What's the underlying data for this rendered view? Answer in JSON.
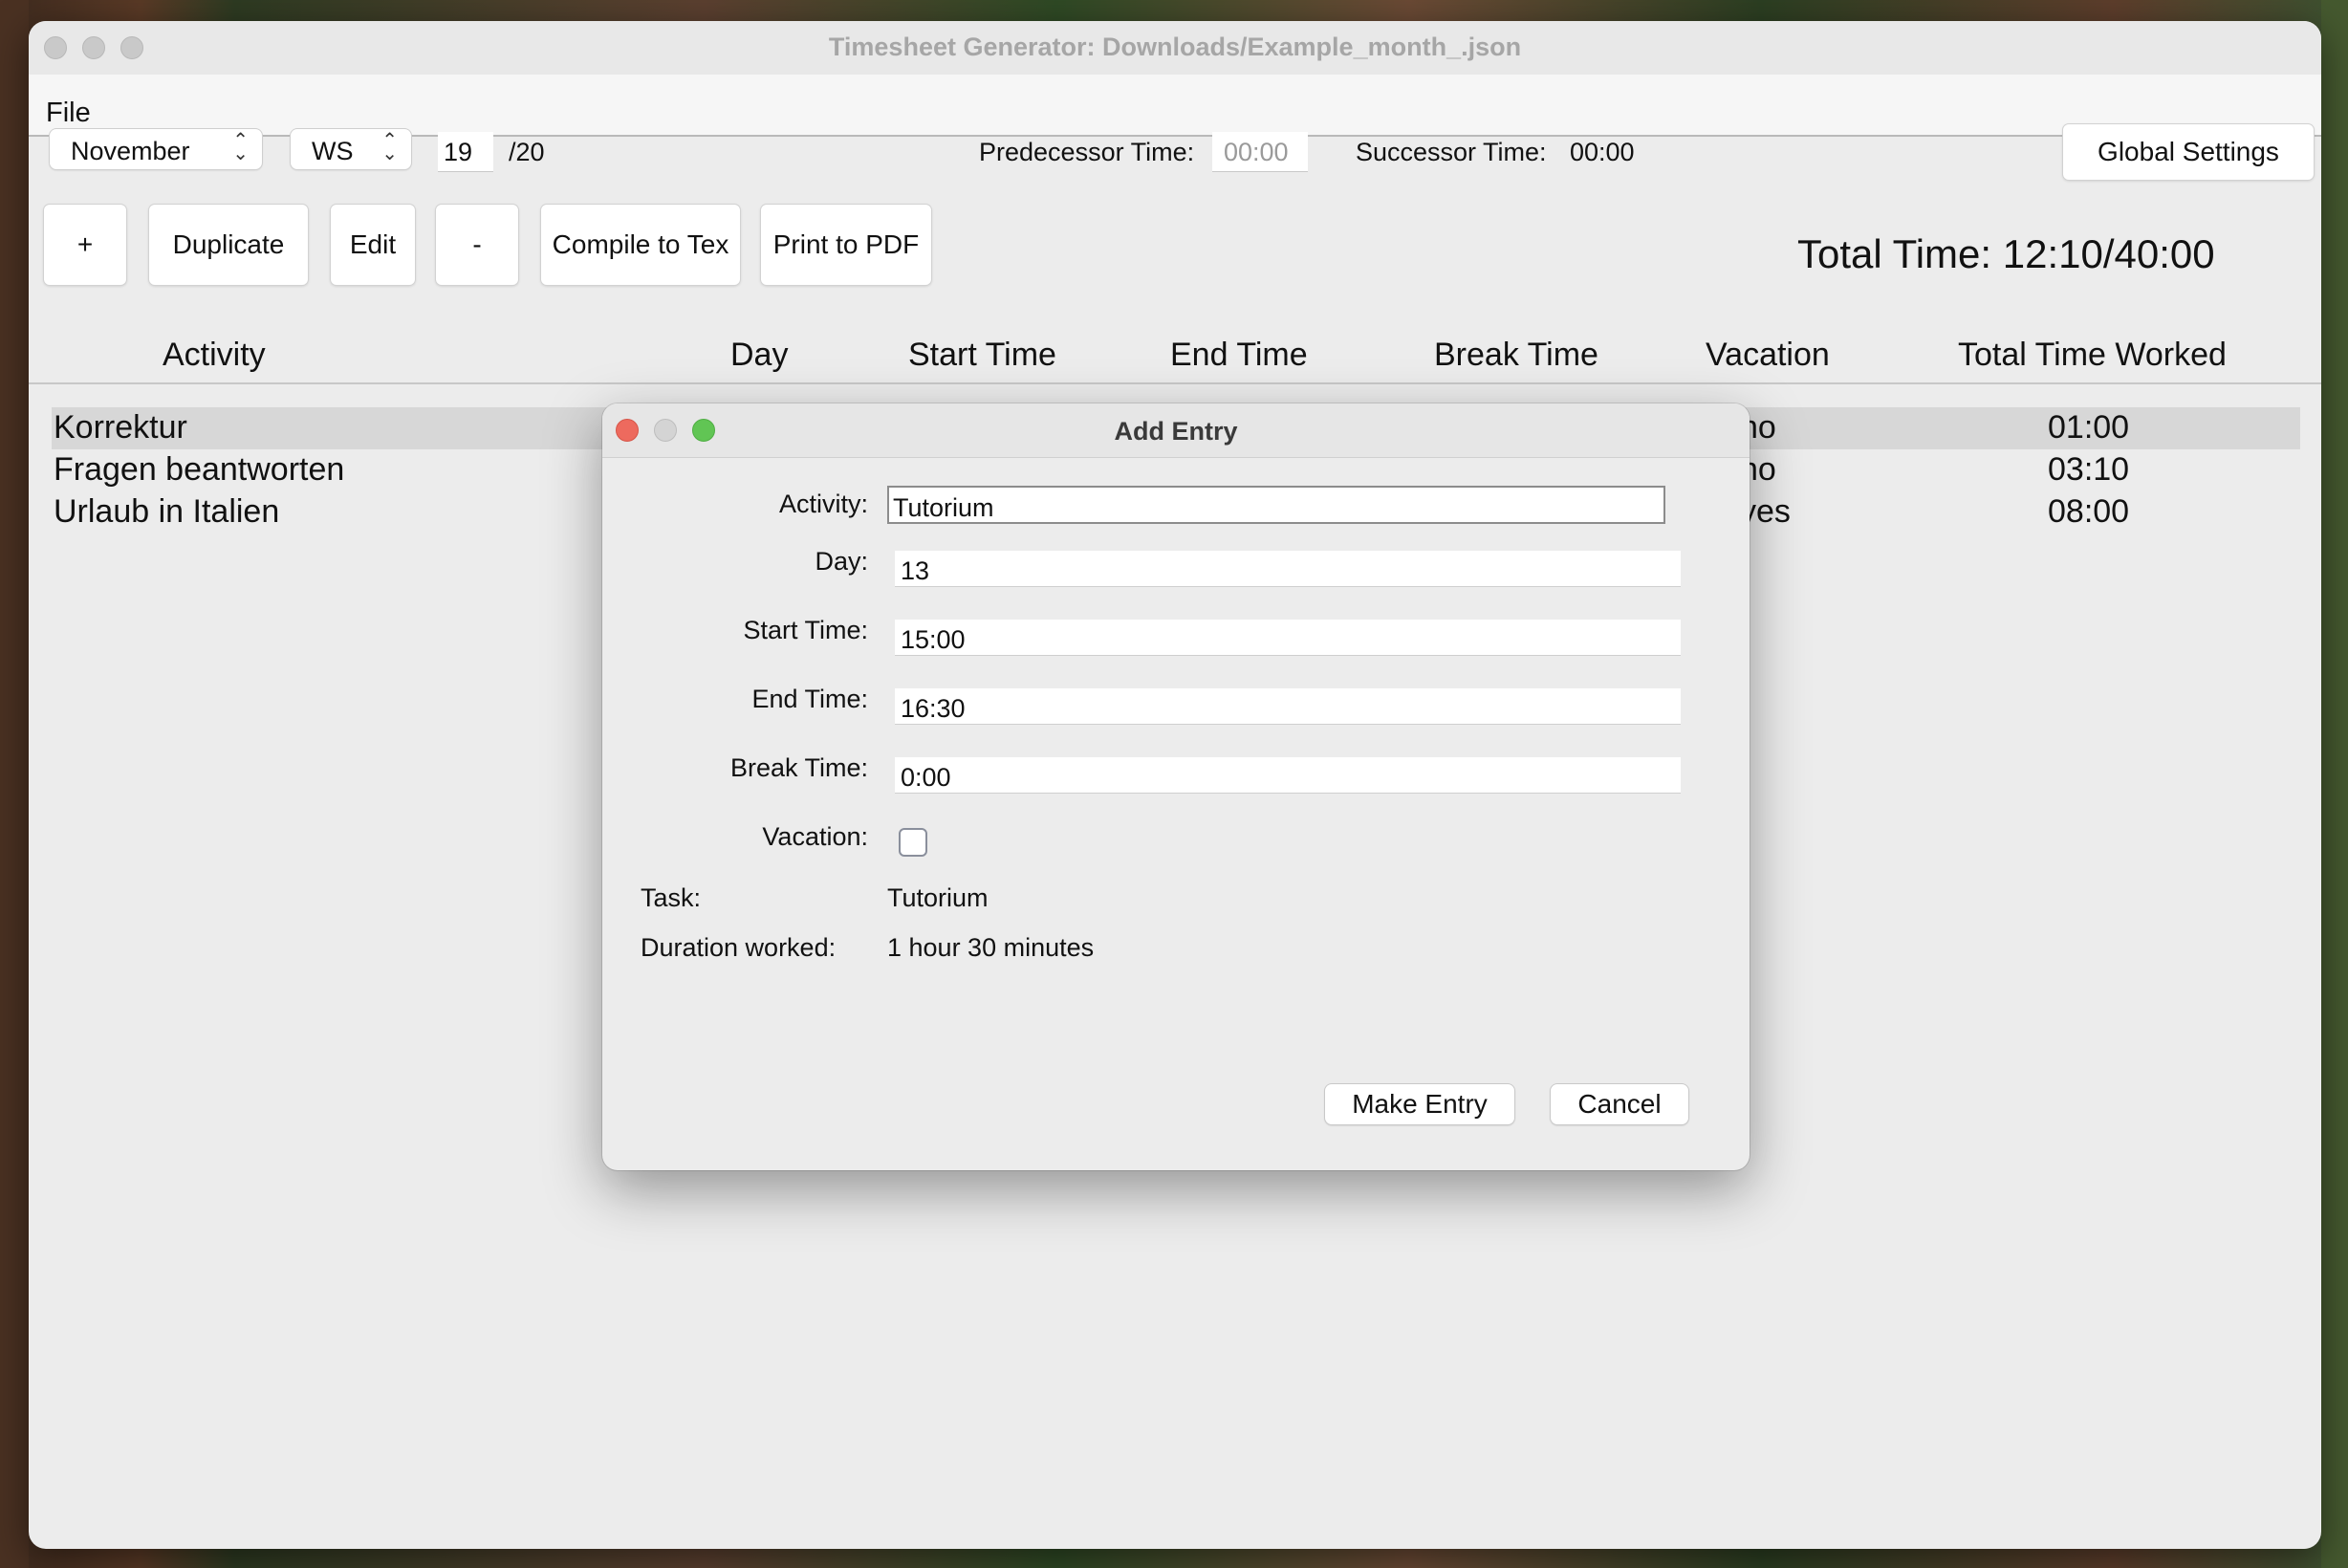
{
  "window": {
    "title": "Timesheet Generator: Downloads/Example_month_.json",
    "menu": [
      "File"
    ]
  },
  "toolbar": {
    "month": "November",
    "semester": "WS",
    "year": "19",
    "year_suffix": "/20",
    "predecessor_label": "Predecessor Time:",
    "predecessor_value": "00:00",
    "successor_label": "Successor Time:",
    "successor_value": "00:00",
    "global_settings": "Global Settings",
    "add": "+",
    "duplicate": "Duplicate",
    "edit": "Edit",
    "remove": "-",
    "compile": "Compile to Tex",
    "print": "Print to PDF",
    "total_time": "Total Time: 12:10/40:00"
  },
  "table": {
    "columns": [
      "Activity",
      "Day",
      "Start Time",
      "End Time",
      "Break Time",
      "Vacation",
      "Total Time Worked"
    ],
    "rows": [
      {
        "activity": "Korrektur",
        "vacation": "no",
        "total": "01:00"
      },
      {
        "activity": "Fragen beantworten",
        "vacation": "no",
        "total": "03:10"
      },
      {
        "activity": "Urlaub in Italien",
        "vacation": "yes",
        "total": "08:00"
      }
    ]
  },
  "dialog": {
    "title": "Add Entry",
    "activity_label": "Activity:",
    "activity_value": "Tutorium",
    "day_label": "Day:",
    "day_value": "13",
    "start_label": "Start Time:",
    "start_value": "15:00",
    "end_label": "End Time:",
    "end_value": "16:30",
    "break_label": "Break Time:",
    "break_value": "0:00",
    "vacation_label": "Vacation:",
    "task_label": "Task:",
    "task_value": "Tutorium",
    "duration_label": "Duration worked:",
    "duration_value": "1 hour 30 minutes",
    "make_entry": "Make Entry",
    "cancel": "Cancel"
  },
  "colors": {
    "close": "#ed6a5e",
    "minimize": "#d4d4d4",
    "zoom": "#61c554"
  }
}
